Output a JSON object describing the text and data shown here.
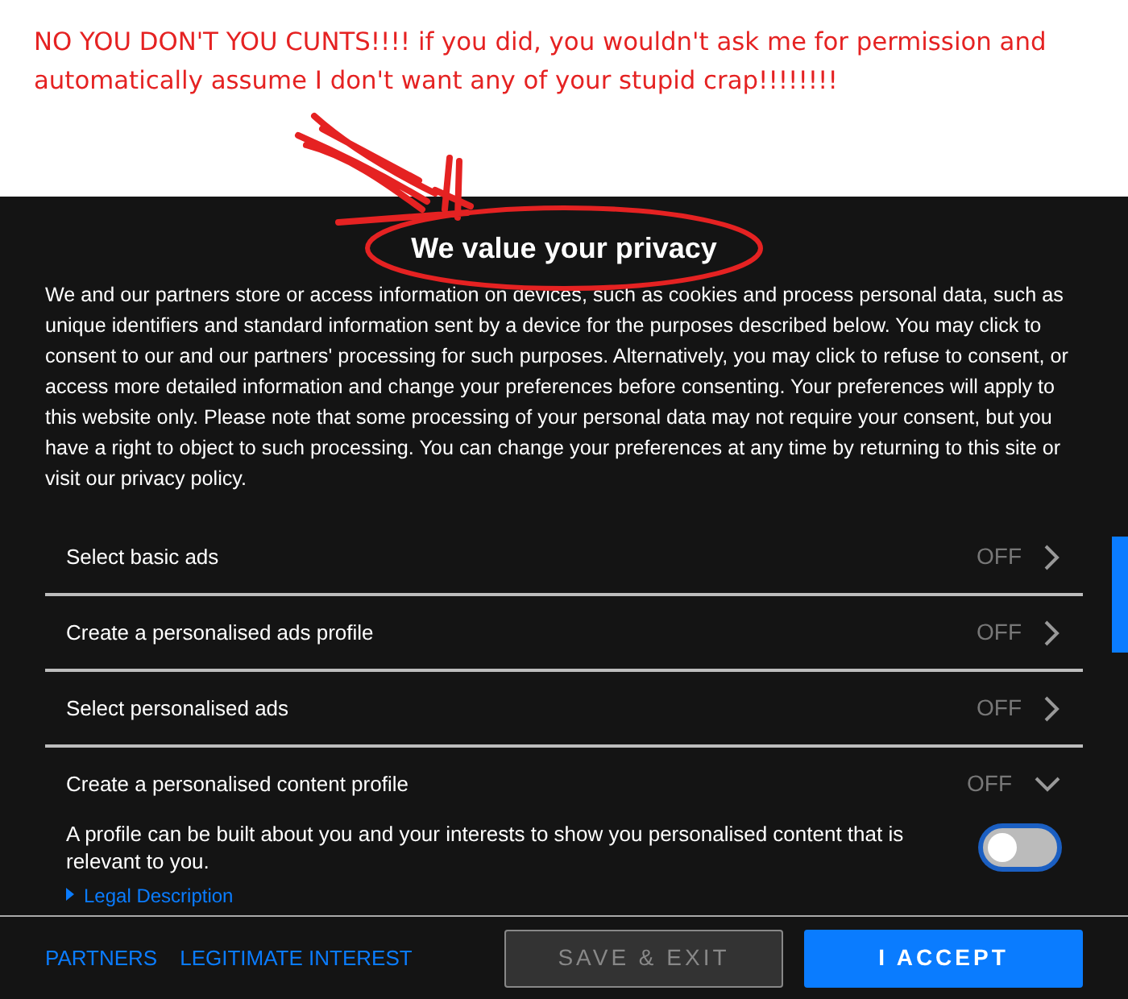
{
  "annotation": {
    "text": "NO YOU DON'T YOU CUNTS!!!! if you did, you wouldn't ask me for permission and automatically assume I don't want any of your stupid crap!!!!!!!!"
  },
  "dialog": {
    "title": "We value your privacy",
    "intro": "We and our partners store or access information on devices, such as cookies and process personal data, such as unique identifiers and standard information sent by a device for the purposes described below. You may click to consent to our and our partners' processing for such purposes. Alternatively, you may click to refuse to consent, or access more detailed information and change your preferences before consenting. Your preferences will apply to this website only. Please note that some processing of your personal data may not require your consent, but you have a right to object to such processing. You can change your preferences at any time by returning to this site or visit our privacy policy.",
    "purposes": [
      {
        "label": "Select basic ads",
        "status": "OFF",
        "expanded": false
      },
      {
        "label": "Create a personalised ads profile",
        "status": "OFF",
        "expanded": false
      },
      {
        "label": "Select personalised ads",
        "status": "OFF",
        "expanded": false
      },
      {
        "label": "Create a personalised content profile",
        "status": "OFF",
        "expanded": true,
        "description": "A profile can be built about you and your interests to show you personalised content that is relevant to you.",
        "on": false,
        "legal_link": "Legal Description"
      }
    ],
    "footer_links": [
      "PARTNERS",
      "LEGITIMATE INTEREST"
    ],
    "buttons": [
      {
        "label": "SAVE & EXIT",
        "kind": "secondary"
      },
      {
        "label": "I ACCEPT",
        "kind": "primary"
      }
    ]
  }
}
